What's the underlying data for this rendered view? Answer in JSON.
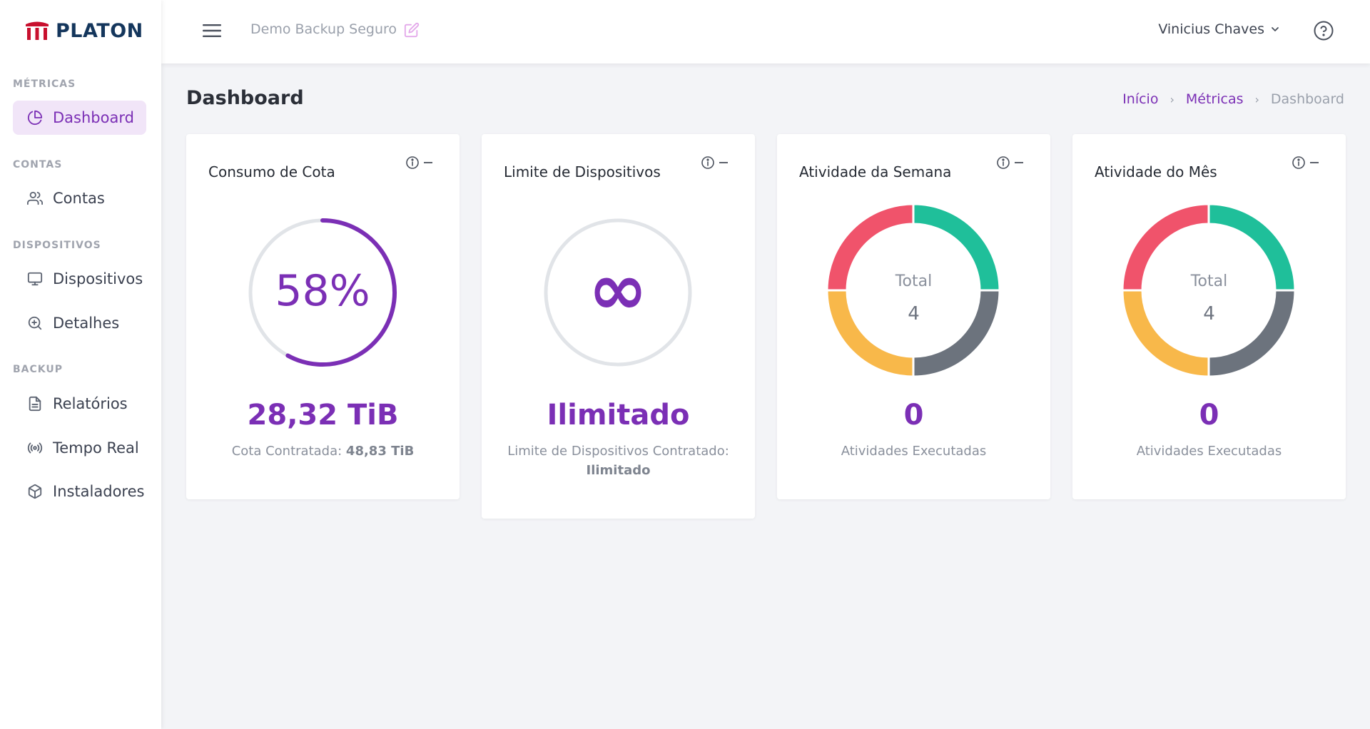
{
  "brand": {
    "name": "PLATON",
    "color": "#14365c",
    "mark_color": "#c8102e"
  },
  "accent_color": "#7b2fb5",
  "sidebar": {
    "sections": [
      {
        "label": "MÉTRICAS",
        "items": [
          {
            "label": "Dashboard",
            "icon": "pie-chart-icon",
            "active": true
          }
        ]
      },
      {
        "label": "CONTAS",
        "items": [
          {
            "label": "Contas",
            "icon": "users-icon"
          }
        ]
      },
      {
        "label": "DISPOSITIVOS",
        "items": [
          {
            "label": "Dispositivos",
            "icon": "monitor-icon"
          },
          {
            "label": "Detalhes",
            "icon": "zoom-in-icon"
          }
        ]
      },
      {
        "label": "BACKUP",
        "items": [
          {
            "label": "Relatórios",
            "icon": "file-text-icon"
          },
          {
            "label": "Tempo Real",
            "icon": "broadcast-icon"
          },
          {
            "label": "Instaladores",
            "icon": "package-icon"
          }
        ]
      }
    ]
  },
  "topbar": {
    "organization": "Demo Backup Seguro",
    "user_name": "Vinicius Chaves"
  },
  "page": {
    "title": "Dashboard",
    "breadcrumb": [
      "Início",
      "Métricas",
      "Dashboard"
    ]
  },
  "cards": {
    "quota": {
      "title": "Consumo de Cota",
      "percent_label": "58%",
      "percent": 58,
      "value": "28,32 TiB",
      "sub_label": "Cota Contratada:",
      "sub_value": "48,83 TiB"
    },
    "devices": {
      "title": "Limite de Dispositivos",
      "symbol": "∞",
      "value": "Ilimitado",
      "sub_label": "Limite de Dispositivos Contratado:",
      "sub_value": "Ilimitado"
    },
    "week": {
      "title": "Atividade da Semana",
      "center_label": "Total",
      "center_value": "4",
      "value": "0",
      "sub_label": "Atividades Executadas"
    },
    "month": {
      "title": "Atividade do Mês",
      "center_label": "Total",
      "center_value": "4",
      "value": "0",
      "sub_label": "Atividades Executadas"
    }
  },
  "donut_colors": [
    "#1fbf9a",
    "#6c737d",
    "#f8b84a",
    "#f0536b"
  ],
  "chart_data": [
    {
      "type": "pie",
      "title": "Atividade da Semana",
      "categories": [
        "",
        "",
        "",
        ""
      ],
      "values": [
        1,
        1,
        1,
        1
      ],
      "colors": [
        "#1fbf9a",
        "#6c737d",
        "#f8b84a",
        "#f0536b"
      ]
    },
    {
      "type": "pie",
      "title": "Atividade do Mês",
      "categories": [
        "",
        "",
        "",
        ""
      ],
      "values": [
        1,
        1,
        1,
        1
      ],
      "colors": [
        "#1fbf9a",
        "#6c737d",
        "#f8b84a",
        "#f0536b"
      ]
    }
  ]
}
